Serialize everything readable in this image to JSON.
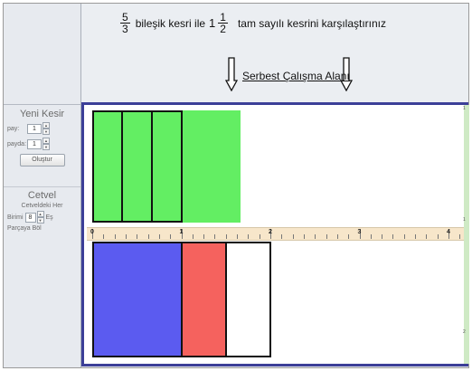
{
  "question": {
    "frac1": {
      "num": "5",
      "den": "3"
    },
    "text1": "bileşik kesri ile",
    "mixed": {
      "whole": "1",
      "num": "1",
      "den": "2"
    },
    "text2": "tam sayılı kesrini karşılaştırınız"
  },
  "work_area_label": "Serbest Çalışma Alanı",
  "sidebar": {
    "new_fraction_title": "Yeni Kesir",
    "pay_label": "pay:",
    "pay_value": "1",
    "payda_label": "payda:",
    "payda_value": "1",
    "create_button": "Oluştur",
    "ruler_title": "Cetvel",
    "ruler_text1": "Cetveldeki Her",
    "ruler_text2a": "Birimi",
    "ruler_value": "8",
    "ruler_text2b": "Eş",
    "ruler_text3": "Parçaya Böl"
  },
  "ruler": {
    "labels": [
      "0",
      "1",
      "2",
      "3",
      "4"
    ],
    "divisions": 8
  },
  "fraction_bars": {
    "top": {
      "label": "5/3",
      "total_units": 5,
      "denominator": 3,
      "color": "#63ee63"
    },
    "bottom": {
      "label": "1 1/2",
      "segments": [
        {
          "value": 1,
          "color": "#5b5bf0"
        },
        {
          "value": 0.5,
          "color": "#f5625e"
        },
        {
          "value": 0.5,
          "color": "#ffffff"
        }
      ]
    }
  },
  "right_strip_labels": [
    "1",
    "1",
    "2"
  ],
  "colors": {
    "work_border": "#3c3f98",
    "ruler_bg": "#f7e6ca"
  }
}
